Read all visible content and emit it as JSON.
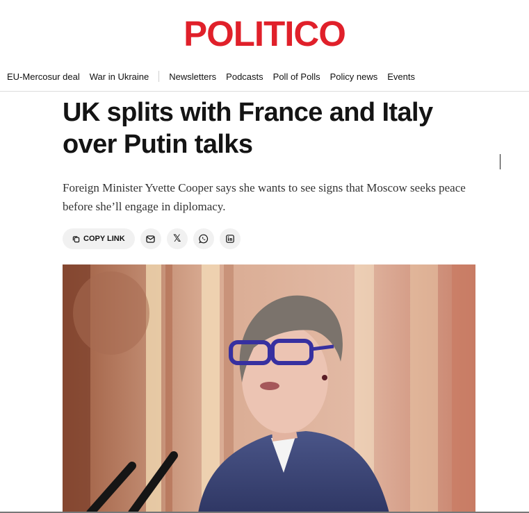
{
  "brand": {
    "logo_text": "POLITICO",
    "accent_color": "#e0202a"
  },
  "nav": {
    "items_left": [
      "EU-Mercosur deal",
      "War in Ukraine"
    ],
    "items_right": [
      "Newsletters",
      "Podcasts",
      "Poll of Polls",
      "Policy news",
      "Events"
    ]
  },
  "article": {
    "headline": "UK splits with France and Italy over Putin talks",
    "dek": "Foreign Minister Yvette Cooper says she wants to see signs that Moscow seeks peace before she’ll engage in diplomacy."
  },
  "share": {
    "copy_link_label": "COPY LINK",
    "x_glyph": "𝕏",
    "icons": [
      "copy-icon",
      "mail-icon",
      "x-icon",
      "whatsapp-icon",
      "linkedin-icon"
    ]
  },
  "hero": {
    "icon": "photo"
  }
}
